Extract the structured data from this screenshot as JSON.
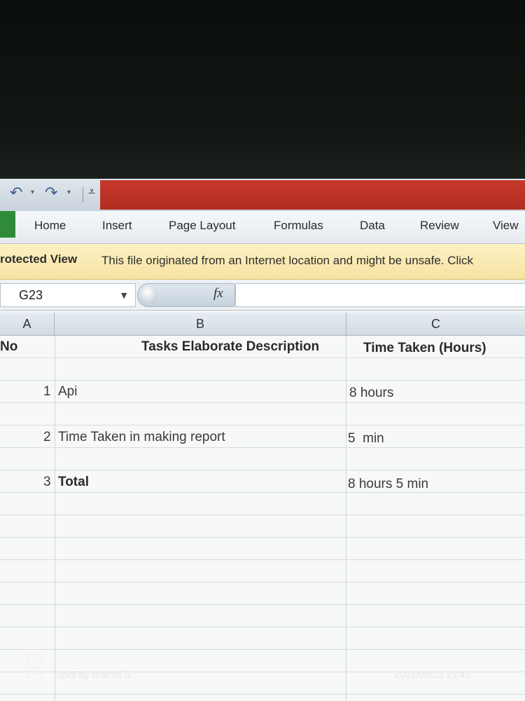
{
  "quick_access": {
    "undo_icon": "undo-icon",
    "redo_icon": "redo-icon",
    "customize_icon": "customize-qat-icon"
  },
  "ribbon": {
    "tabs": [
      "Home",
      "Insert",
      "Page Layout",
      "Formulas",
      "Data",
      "Review",
      "View"
    ]
  },
  "protected_view": {
    "title": "rotected View",
    "message": "This file originated from an Internet location and might be unsafe. Click"
  },
  "formula_bar": {
    "name_box": "G23",
    "fx_label": "fx",
    "formula": ""
  },
  "sheet": {
    "columns": [
      "A",
      "B",
      "C"
    ],
    "header_row": {
      "a": "No",
      "b": "Tasks Elaborate Description",
      "c": "Time Taken (Hours)"
    },
    "rows": [
      {
        "no": "1",
        "task": "Api",
        "time": "8 hours"
      },
      {
        "no": "2",
        "task": "Time Taken in making report",
        "time": "5  min"
      },
      {
        "no": "3",
        "task": "Total",
        "time": "8 hours 5 min"
      }
    ]
  },
  "camera_watermark": {
    "title": "AI QUAD CAMERA",
    "subtitle": "Shot by realme 5",
    "datetime": "2021/08/23 23:43"
  },
  "colors": {
    "title_bar": "#c7382c",
    "file_tab": "#2f8b3a",
    "protected_view_bg": "#fdf1c3"
  }
}
